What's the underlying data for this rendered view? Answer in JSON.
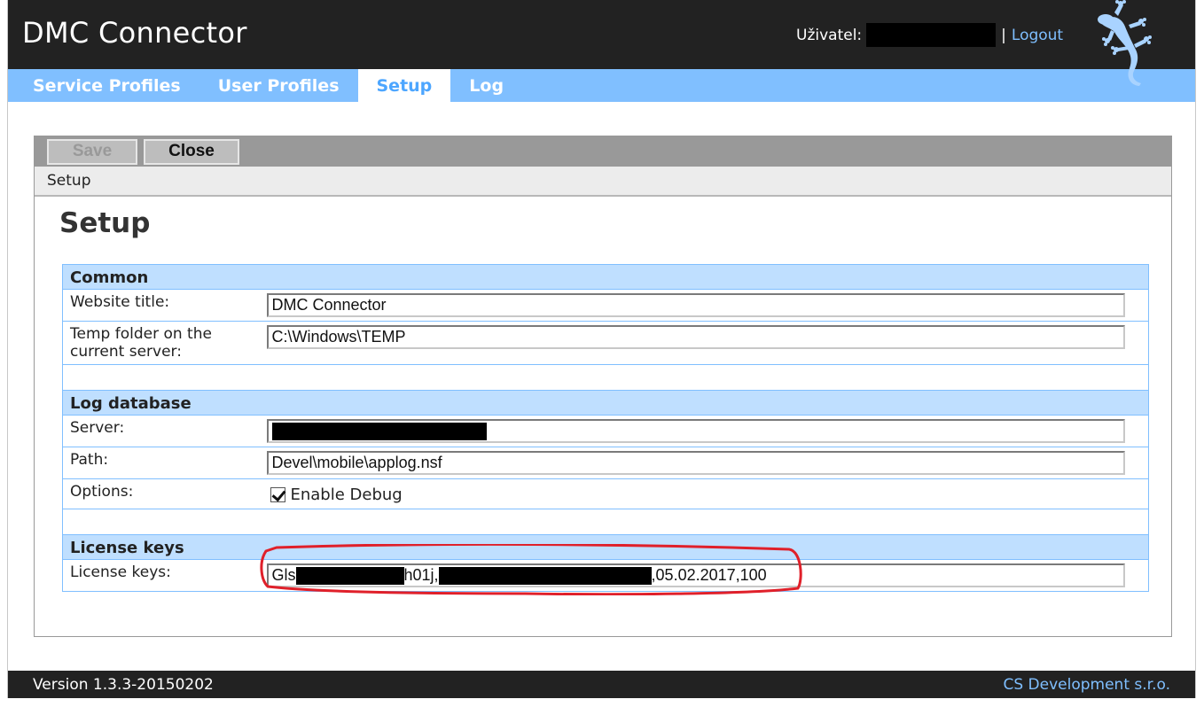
{
  "header": {
    "app_title": "DMC Connector",
    "user_label": "Uživatel:",
    "user_name": "",
    "separator": "|",
    "logout_label": "Logout",
    "logo_icon": "gecko-icon"
  },
  "nav": {
    "tabs": [
      {
        "label": "Service Profiles",
        "active": false
      },
      {
        "label": "User Profiles",
        "active": false
      },
      {
        "label": "Setup",
        "active": true
      },
      {
        "label": "Log",
        "active": false
      }
    ]
  },
  "toolbar": {
    "save_label": "Save",
    "save_enabled": false,
    "close_label": "Close"
  },
  "breadcrumb": "Setup",
  "page_title": "Setup",
  "form": {
    "common": {
      "heading": "Common",
      "website_title_label": "Website title:",
      "website_title_value": "DMC Connector",
      "temp_folder_label": "Temp folder on the current server:",
      "temp_folder_value": "C:\\Windows\\TEMP"
    },
    "log_database": {
      "heading": "Log database",
      "server_label": "Server:",
      "server_value": "[redacted]",
      "path_label": "Path:",
      "path_value": "Devel\\mobile\\applog.nsf",
      "options_label": "Options:",
      "enable_debug_label": "Enable Debug",
      "enable_debug_checked": true
    },
    "license": {
      "heading": "License keys",
      "license_label": "License keys:",
      "license_prefix": "Gls",
      "license_mid": "h01j,",
      "license_suffix": ",05.02.2017,100"
    }
  },
  "annotation": {
    "highlight_color": "#e0202a"
  },
  "footer": {
    "version": "Version 1.3.3-20150202",
    "company": "CS Development s.r.o."
  },
  "colors": {
    "header_bg": "#222222",
    "nav_bg": "#80bfff",
    "accent": "#4da6ff",
    "section_bg": "#bfdfff"
  }
}
